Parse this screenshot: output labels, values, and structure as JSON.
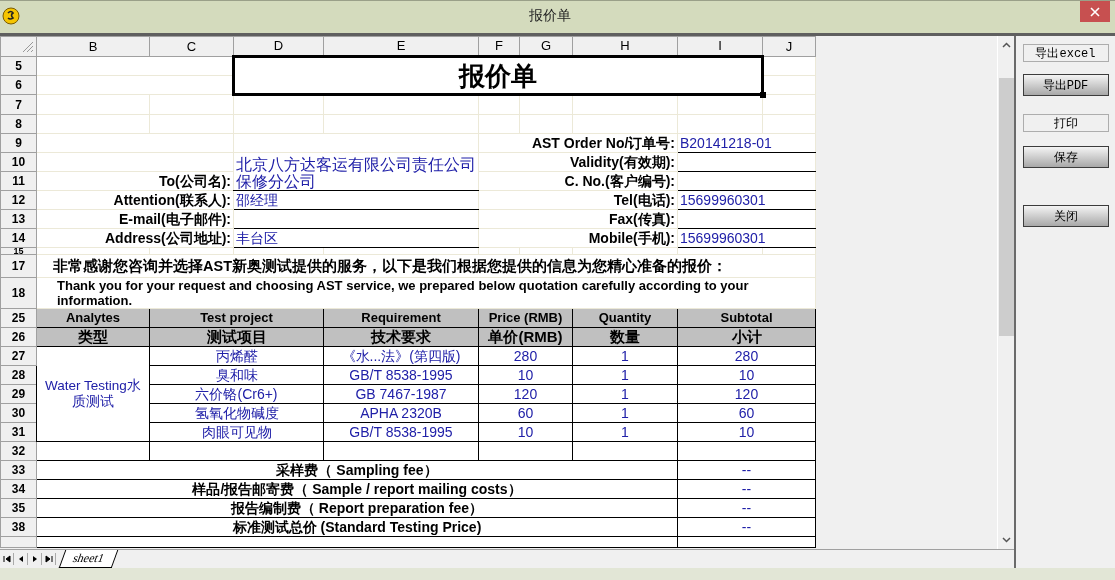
{
  "window": {
    "title": "报价单"
  },
  "sheet": {
    "columns": [
      "B",
      "C",
      "D",
      "E",
      "F",
      "G",
      "H",
      "I",
      "J"
    ],
    "rows": [
      {
        "number": "5",
        "kind": "title",
        "text": "报价单"
      },
      {
        "number": "6",
        "kind": "title_rest"
      },
      {
        "number": "7",
        "kind": "blank"
      },
      {
        "number": "8",
        "kind": "blank"
      },
      {
        "number": "9",
        "kind": "info",
        "right_label": "AST Order No/订单号:",
        "right_value": "B20141218-01"
      },
      {
        "number": "10",
        "kind": "info_span",
        "left_value": "北京八方达客运有限公司责任公司保修分公司",
        "right_label": "Validity(有效期):"
      },
      {
        "number": "11",
        "kind": "info_spanned",
        "left_label": "To(公司名):",
        "right_label": "C. No.(客户编号):"
      },
      {
        "number": "12",
        "kind": "info",
        "left_label": "Attention(联系人):",
        "left_value": "邵经理",
        "right_label": "Tel(电话):",
        "right_value": "15699960301"
      },
      {
        "number": "13",
        "kind": "info",
        "left_label": "E-mail(电子邮件):",
        "right_label": "Fax(传真):"
      },
      {
        "number": "14",
        "kind": "info",
        "left_label": "Address(公司地址):",
        "left_value": "丰台区",
        "right_label": "Mobile(手机):",
        "right_value": "15699960301"
      },
      {
        "number": "15",
        "kind": "spacer"
      },
      {
        "number": "17",
        "kind": "notice_cn",
        "text": "非常感谢您咨询并选择AST新奥测试提供的服务，以下是我们根据您提供的信息为您精心准备的报价："
      },
      {
        "number": "18",
        "kind": "notice_en",
        "text": "Thank you for your request and choosing AST service, we prepared below quotation carefully according to your information."
      },
      {
        "number": "25",
        "kind": "head_en",
        "cells": [
          "Analytes",
          "Test project",
          "Requirement",
          "Price (RMB)",
          "Quantity",
          "Subtotal"
        ]
      },
      {
        "number": "26",
        "kind": "head_cn",
        "cells": [
          "类型",
          "测试项目",
          "技术要求",
          "单价(RMB)",
          "数量",
          "小计"
        ]
      },
      {
        "number": "27",
        "kind": "item_first",
        "analyte": "Water Testing水质测试",
        "project": "丙烯醛",
        "requirement": "《水...法》(第四版)",
        "price": "280",
        "quantity": "1",
        "subtotal": "280"
      },
      {
        "number": "28",
        "kind": "item",
        "project": "臭和味",
        "requirement": "GB/T 8538-1995",
        "price": "10",
        "quantity": "1",
        "subtotal": "10"
      },
      {
        "number": "29",
        "kind": "item",
        "project": "六价铬(Cr6+)",
        "requirement": "GB 7467-1987",
        "price": "120",
        "quantity": "1",
        "subtotal": "120"
      },
      {
        "number": "30",
        "kind": "item",
        "project": "氢氧化物碱度",
        "requirement": "APHA 2320B",
        "price": "60",
        "quantity": "1",
        "subtotal": "60"
      },
      {
        "number": "31",
        "kind": "item",
        "project": "肉眼可见物",
        "requirement": "GB/T 8538-1995",
        "price": "10",
        "quantity": "1",
        "subtotal": "10"
      },
      {
        "number": "32",
        "kind": "empty_item"
      },
      {
        "number": "33",
        "kind": "fee",
        "label": "采样费（ Sampling fee）",
        "value": "--"
      },
      {
        "number": "34",
        "kind": "fee",
        "label": "样品/报告邮寄费（ Sample / report mailing costs）",
        "value": "--"
      },
      {
        "number": "35",
        "kind": "fee",
        "label": "报告编制费（ Report preparation fee）",
        "value": "--"
      },
      {
        "number": "38",
        "kind": "fee",
        "label": "标准测试总价 (Standard Testing Price)",
        "value": "--"
      },
      {
        "kind": "cut"
      }
    ]
  },
  "sheet_tabs": [
    {
      "label": "sheet1",
      "selected": true
    }
  ],
  "buttons": [
    {
      "label": "导出excel",
      "kind": "flat"
    },
    {
      "label": "导出PDF",
      "kind": "raised"
    },
    {
      "label": "打印",
      "kind": "flat"
    },
    {
      "label": "保存",
      "kind": "raised"
    },
    {
      "label": "关闭",
      "kind": "raised"
    }
  ]
}
